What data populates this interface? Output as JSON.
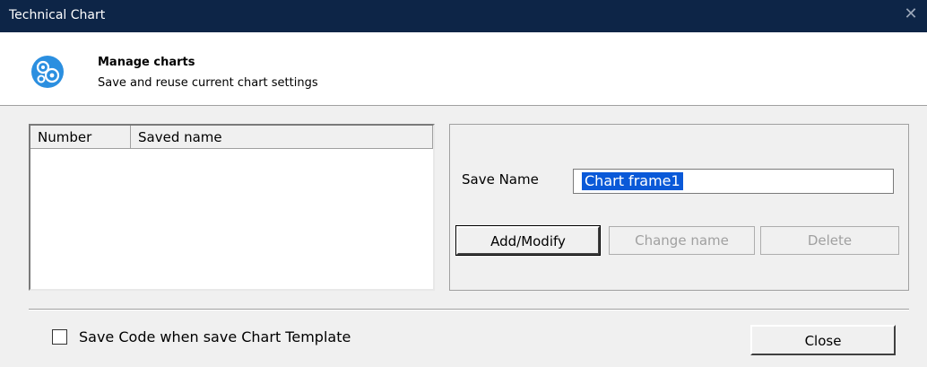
{
  "window": {
    "title": "Technical Chart",
    "close_icon": "close-icon"
  },
  "header": {
    "icon": "gears-icon",
    "title": "Manage charts",
    "subtitle": "Save and reuse current chart settings",
    "accent": "#2b8fe0"
  },
  "list": {
    "columns": [
      "Number",
      "Saved name"
    ],
    "rows": []
  },
  "form": {
    "save_name_label": "Save Name",
    "save_name_value": "Chart frame1",
    "selection_color": "#0a59d8"
  },
  "buttons": {
    "add_modify": "Add/Modify",
    "change_name": "Change name",
    "delete": "Delete",
    "close": "Close"
  },
  "footer": {
    "checkbox_label": "Save Code when save Chart Template",
    "checkbox_checked": false
  }
}
